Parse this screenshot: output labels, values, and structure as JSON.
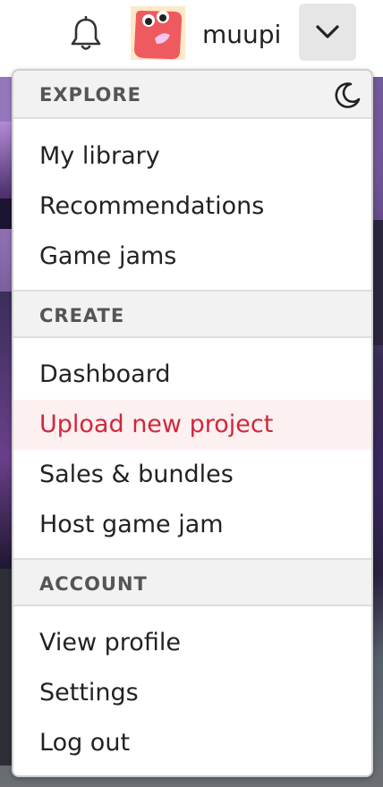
{
  "header": {
    "username": "muupi",
    "notifications_icon": "bell-icon",
    "menu_toggle_icon": "chevron-down-icon"
  },
  "dropdown": {
    "sections": [
      {
        "title": "EXPLORE",
        "items": [
          "My library",
          "Recommendations",
          "Game jams"
        ]
      },
      {
        "title": "CREATE",
        "items": [
          "Dashboard",
          "Upload new project",
          "Sales & bundles",
          "Host game jam"
        ]
      },
      {
        "title": "ACCOUNT",
        "items": [
          "View profile",
          "Settings",
          "Log out"
        ]
      }
    ],
    "theme_toggle_icon": "moon-icon",
    "active_item": "Upload new project"
  },
  "colors": {
    "accent": "#d0283b",
    "active_bg": "#fdf0f1",
    "section_bg": "#f2f2f2",
    "toggle_bg": "#e6e6e6"
  }
}
